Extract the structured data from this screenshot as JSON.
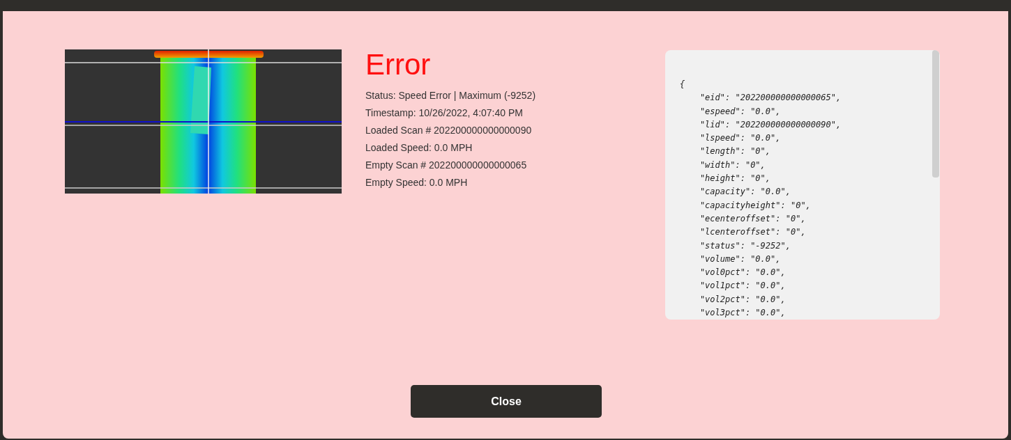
{
  "dialog": {
    "title": "Error",
    "details": [
      "Status: Speed Error | Maximum (-9252)",
      "Timestamp: 10/26/2022, 4:07:40 PM",
      "Loaded Scan # 202200000000000090",
      "Loaded Speed: 0.0 MPH",
      "Empty Scan # 202200000000000065",
      "Empty Speed: 0.0 MPH"
    ],
    "json_lines": [
      "{",
      "    \"eid\": \"202200000000000065\",",
      "    \"espeed\": \"0.0\",",
      "    \"lid\": \"202200000000000090\",",
      "    \"lspeed\": \"0.0\",",
      "    \"length\": \"0\",",
      "    \"width\": \"0\",",
      "    \"height\": \"0\",",
      "    \"capacity\": \"0.0\",",
      "    \"capacityheight\": \"0\",",
      "    \"ecenteroffset\": \"0\",",
      "    \"lcenteroffset\": \"0\",",
      "    \"status\": \"-9252\",",
      "    \"volume\": \"0.0\",",
      "    \"vol0pct\": \"0.0\",",
      "    \"vol1pct\": \"0.0\",",
      "    \"vol2pct\": \"0.0\",",
      "    \"vol3pct\": \"0.0\","
    ],
    "close_button": "Close"
  }
}
